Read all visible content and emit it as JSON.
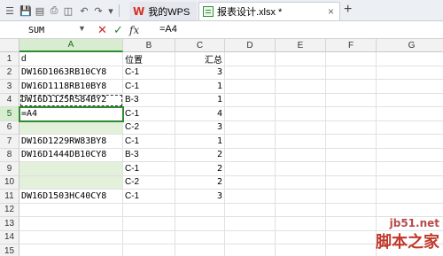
{
  "tabs": {
    "home_label": "我的WPS",
    "file_label": "报表设计.xlsx *"
  },
  "formula_bar": {
    "name_box": "SUM",
    "fx_label": "fx",
    "formula": "=A4"
  },
  "columns": [
    "A",
    "B",
    "C",
    "D",
    "E",
    "F",
    "G"
  ],
  "active_column": "A",
  "rows": [
    {
      "num": "1",
      "a": "d",
      "b": "位置",
      "c": "汇总"
    },
    {
      "num": "2",
      "a": "DW16D1063RB10CY8",
      "b": "C-1",
      "c": "3"
    },
    {
      "num": "3",
      "a": "DW16D1118RB10BY8",
      "b": "C-1",
      "c": "1"
    },
    {
      "num": "4",
      "a": "DW16D1125RS84BY2",
      "b": "B-3",
      "c": "1"
    },
    {
      "num": "5",
      "a": "=A4",
      "b": "C-1",
      "c": "4"
    },
    {
      "num": "6",
      "a": "",
      "b": "C-2",
      "c": "3"
    },
    {
      "num": "7",
      "a": "DW16D1229RW83BY8",
      "b": "C-1",
      "c": "1"
    },
    {
      "num": "8",
      "a": "DW16D1444DB10CY8",
      "b": "B-3",
      "c": "2"
    },
    {
      "num": "9",
      "a": "",
      "b": "C-1",
      "c": "2"
    },
    {
      "num": "10",
      "a": "",
      "b": "C-2",
      "c": "2"
    },
    {
      "num": "11",
      "a": "DW16D1503HC40CY8",
      "b": "C-1",
      "c": "3"
    },
    {
      "num": "12",
      "a": "",
      "b": "",
      "c": ""
    },
    {
      "num": "13",
      "a": "",
      "b": "",
      "c": ""
    },
    {
      "num": "14",
      "a": "",
      "b": "",
      "c": ""
    },
    {
      "num": "15",
      "a": "",
      "b": "",
      "c": ""
    }
  ],
  "watermark": {
    "line1": "jb51.net",
    "line2": "脚本之家"
  }
}
